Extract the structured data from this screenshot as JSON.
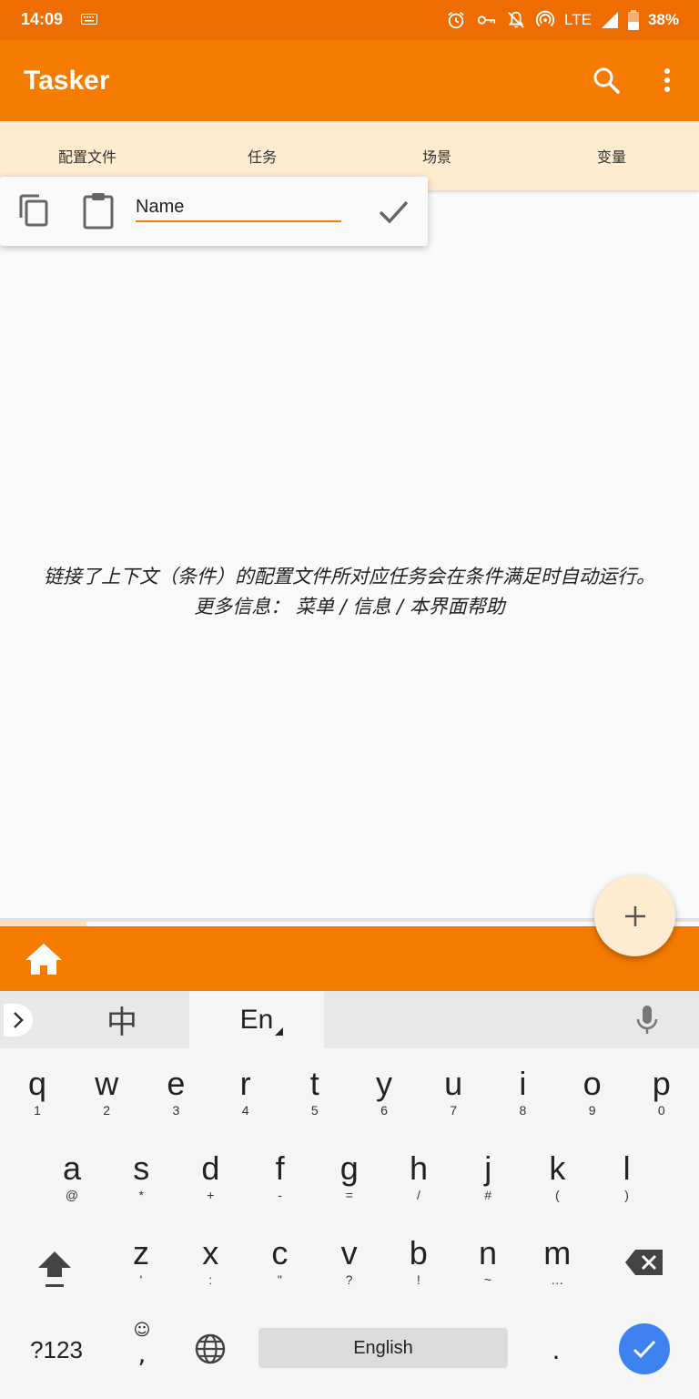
{
  "status_bar": {
    "time": "14:09",
    "network": "LTE",
    "battery": "38%",
    "icons": [
      "keyboard-icon",
      "alarm-icon",
      "vpn-key-icon",
      "notifications-off-icon",
      "hotspot-icon",
      "signal-icon",
      "battery-icon"
    ]
  },
  "app_bar": {
    "title": "Tasker",
    "icons": [
      "search-icon",
      "more-vert-icon"
    ]
  },
  "tabs": [
    "配置文件",
    "任务",
    "场景",
    "变量"
  ],
  "popup": {
    "input_value": "Name",
    "icons": [
      "copy-icon",
      "paste-icon",
      "check-icon"
    ]
  },
  "help": {
    "line1": "链接了上下文（条件）的配置文件所对应任务会在条件满足时自动运行。",
    "line2": "更多信息： 菜单 / 信息 / 本界面帮助"
  },
  "bottom_bar": {
    "icons": [
      "home-icon",
      "add-icon"
    ]
  },
  "keyboard": {
    "lang_zh": "中",
    "lang_en": "En",
    "row1": [
      {
        "k": "q",
        "s": "1"
      },
      {
        "k": "w",
        "s": "2"
      },
      {
        "k": "e",
        "s": "3"
      },
      {
        "k": "r",
        "s": "4"
      },
      {
        "k": "t",
        "s": "5"
      },
      {
        "k": "y",
        "s": "6"
      },
      {
        "k": "u",
        "s": "7"
      },
      {
        "k": "i",
        "s": "8"
      },
      {
        "k": "o",
        "s": "9"
      },
      {
        "k": "p",
        "s": "0"
      }
    ],
    "row2": [
      {
        "k": "a",
        "s": "@"
      },
      {
        "k": "s",
        "s": "*"
      },
      {
        "k": "d",
        "s": "+"
      },
      {
        "k": "f",
        "s": "-"
      },
      {
        "k": "g",
        "s": "="
      },
      {
        "k": "h",
        "s": "/"
      },
      {
        "k": "j",
        "s": "#"
      },
      {
        "k": "k",
        "s": "("
      },
      {
        "k": "l",
        "s": ")"
      }
    ],
    "row3": [
      {
        "k": "z",
        "s": "'"
      },
      {
        "k": "x",
        "s": ":"
      },
      {
        "k": "c",
        "s": "\""
      },
      {
        "k": "v",
        "s": "?"
      },
      {
        "k": "b",
        "s": "!"
      },
      {
        "k": "n",
        "s": "~"
      },
      {
        "k": "m",
        "s": "…"
      }
    ],
    "sym_label": "?123",
    "emoji": "☺",
    "comma": ",",
    "space_label": "English",
    "period": ".",
    "accent": "#3d82f0"
  },
  "colors": {
    "status_bar": "#ef6c00",
    "app_bar": "#f57c00",
    "tabs_bg": "#ffebd0"
  }
}
